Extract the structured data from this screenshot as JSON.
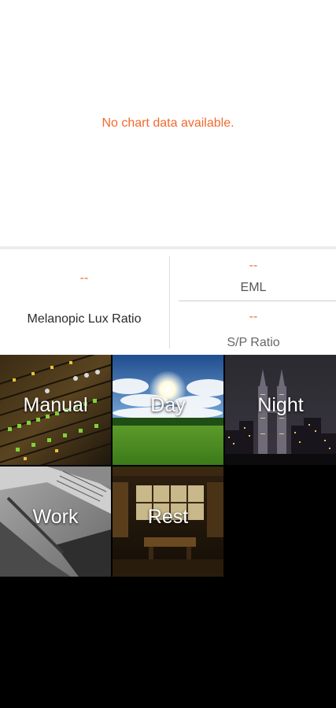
{
  "chart": {
    "empty_message": "No chart data available."
  },
  "metrics": {
    "melanopic": {
      "value": "--",
      "label": "Melanopic Lux Ratio"
    },
    "eml": {
      "value": "--",
      "label": "EML"
    },
    "sp_ratio": {
      "value": "--",
      "label": "S/P Ratio"
    }
  },
  "scenes": [
    {
      "label": "Manual",
      "image": "mixing-console"
    },
    {
      "label": "Day",
      "image": "sunny-field"
    },
    {
      "label": "Night",
      "image": "city-skyline-night"
    },
    {
      "label": "Work",
      "image": "laptop-desk"
    },
    {
      "label": "Rest",
      "image": "living-room"
    }
  ],
  "colors": {
    "accent": "#f26a2e",
    "background": "#000000",
    "panel": "#ffffff"
  }
}
